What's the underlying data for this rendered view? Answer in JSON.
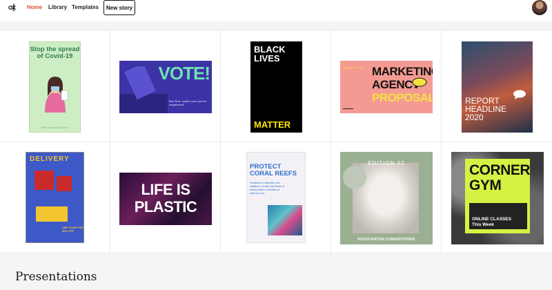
{
  "nav": {
    "links": [
      {
        "label": "Home",
        "active": true
      },
      {
        "label": "Library",
        "active": false
      },
      {
        "label": "Templates",
        "active": false
      }
    ],
    "new_story_label": "New story",
    "accent": "#d9532e"
  },
  "templates": [
    {
      "id": "covid",
      "title": "Stop the spread of Covid-19",
      "footer": "#StopTheSpreadOfCovid"
    },
    {
      "id": "vote",
      "title": "VOTE!",
      "subtitle": "But first, make sure you're registered."
    },
    {
      "id": "blm",
      "title_top": "BLACK LIVES",
      "title_bottom": "MATTER"
    },
    {
      "id": "marketing",
      "title_line1": "MARKETING",
      "title_line2": "AGENCY",
      "title_line3": "PROPOSAL",
      "tag": "Agency name. Date"
    },
    {
      "id": "report",
      "title_line1": "REPORT",
      "title_line2": "HEADLINE",
      "title_line3": "2020"
    },
    {
      "id": "delivery",
      "title": "DELIVERY",
      "code": "USE CODE FOR 30% OFF"
    },
    {
      "id": "plastic",
      "title_line1": "LIFE IS",
      "title_line2": "PLASTIC"
    },
    {
      "id": "coral",
      "title_line1": "PROTECT",
      "title_line2": "CORAL REEFS",
      "body": "Vestibulum a imperdiet nunc, sagittis ex. Id ante eget lectus at metus pretium venenatis sit amet non orci."
    },
    {
      "id": "edition",
      "title": "EDITION 02",
      "footer": "KICKSTARTER.COM/EDITION02"
    },
    {
      "id": "gym",
      "title_line1": "CORNER",
      "title_line2": "GYM",
      "subtitle_line1": "ONLINE CLASSES",
      "subtitle_line2": "This Week"
    }
  ],
  "sections": {
    "presentations_heading": "Presentations"
  }
}
